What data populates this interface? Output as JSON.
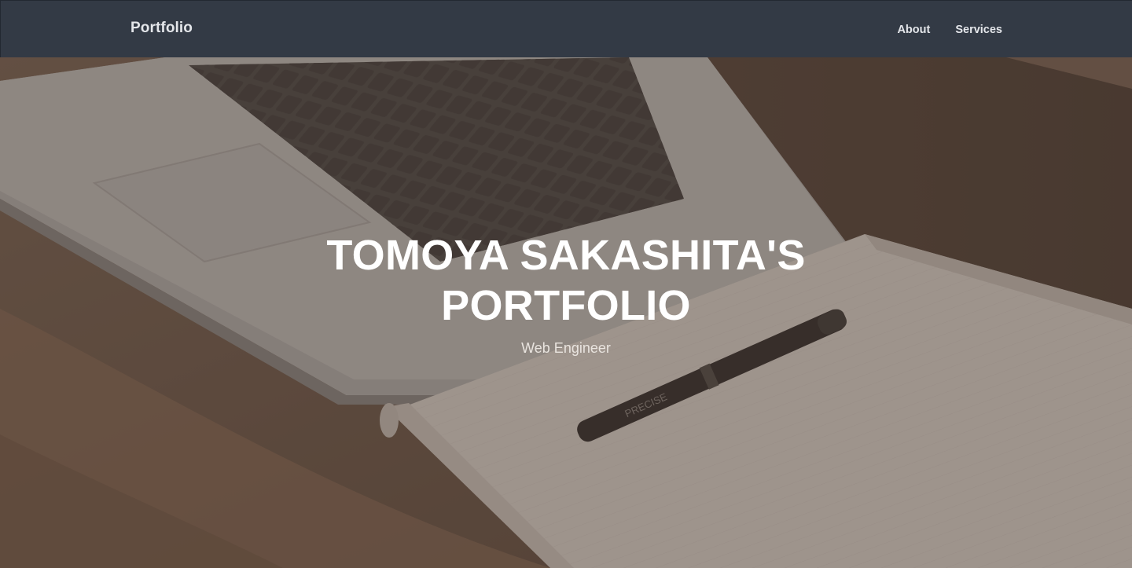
{
  "navbar": {
    "brand": "Portfolio",
    "links": [
      "About",
      "Services"
    ]
  },
  "hero": {
    "title": "TOMOYA SAKASHITA'S PORTFOLIO",
    "subtitle": "Web Engineer",
    "pen_label": "PRECISE"
  },
  "colors": {
    "navbar_bg": "#333a45",
    "text_light": "#e4e6ea",
    "hero_title": "#ffffff",
    "overlay": "#463a32"
  }
}
